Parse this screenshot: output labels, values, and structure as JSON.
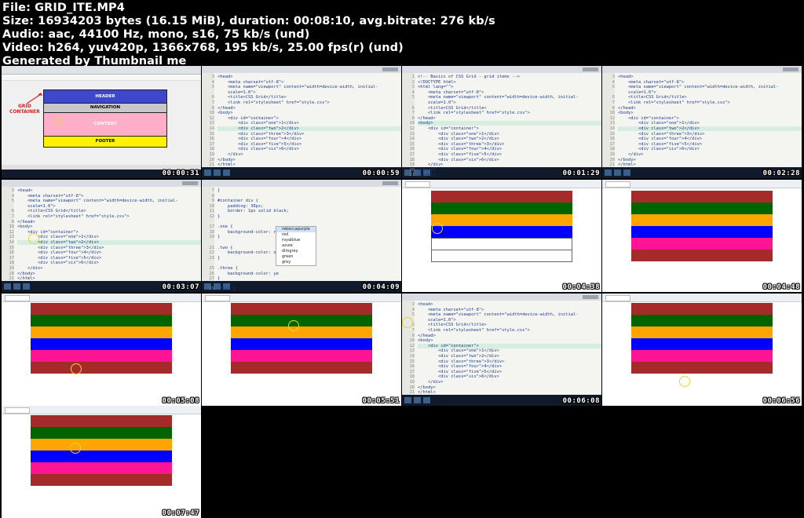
{
  "meta": {
    "file": "File: GRID_ITE.MP4",
    "size": "Size: 16934203 bytes (16.15 MiB), duration: 00:08:10, avg.bitrate: 276 kb/s",
    "audio": "Audio: aac, 44100 Hz, mono, s16, 75 kb/s (und)",
    "video": "Video: h264, yuv420p, 1366x768, 195 kb/s, 25.00 fps(r) (und)",
    "generated": "Generated by Thumbnail me"
  },
  "timestamps": [
    "00:00:31",
    "00:00:59",
    "00:01:29",
    "00:02:28",
    "00:03:07",
    "00:04:09",
    "00:04:38",
    "00:04:48",
    "00:05:08",
    "00:05:51",
    "00:06:08",
    "00:06:56",
    "00:07:47"
  ],
  "diagram": {
    "label_line1": "GRID",
    "label_line2": "CONTAINER",
    "header": "HEADER",
    "navigation": "NAVIGATION",
    "content": "CONTENT",
    "footer": "FOOTER",
    "colors": {
      "header": "#3f48cc",
      "navigation": "#c8c8c8",
      "content": "#ffaec9",
      "footer": "#fff200",
      "label": "#e02020"
    }
  },
  "code_html": [
    {
      "n": "3",
      "t": "<head>"
    },
    {
      "n": "4",
      "t": "    <meta charset=\"utf-8\">"
    },
    {
      "n": "5",
      "t": "    <meta name=\"viewport\" content=\"width=device-width, initial-"
    },
    {
      "n": "",
      "t": "    scale=1.0\">"
    },
    {
      "n": "6",
      "t": "    <title>CSS Grid</title>"
    },
    {
      "n": "7",
      "t": "    <link rel=\"stylesheet\" href=\"style.css\">"
    },
    {
      "n": "8",
      "t": "</head>"
    },
    {
      "n": "10",
      "t": "<body>"
    },
    {
      "n": "12",
      "t": "    <div id=\"container\">"
    },
    {
      "n": "13",
      "t": "        <div class=\"one\">1</div>"
    },
    {
      "n": "14",
      "t": "        <div class=\"two\">2</div>"
    },
    {
      "n": "15",
      "t": "        <div class=\"three\">3</div>"
    },
    {
      "n": "16",
      "t": "        <div class=\"four\">4</div>"
    },
    {
      "n": "17",
      "t": "        <div class=\"five\">5</div>"
    },
    {
      "n": "18",
      "t": "        <div class=\"six\">6</div>"
    },
    {
      "n": "19",
      "t": "    </div>"
    },
    {
      "n": "20",
      "t": "</body>"
    },
    {
      "n": "21",
      "t": "</html>"
    }
  ],
  "code_top": [
    {
      "n": "1",
      "t": "<!-- Basics of CSS Grid - grid items -->"
    },
    {
      "n": "2",
      "t": "<!DOCTYPE html>"
    },
    {
      "n": "3",
      "t": "<html lang=\"\">"
    }
  ],
  "code_css": [
    {
      "n": "7",
      "t": "}"
    },
    {
      "n": "8",
      "t": ""
    },
    {
      "n": "9",
      "t": "#container div {"
    },
    {
      "n": "10",
      "t": "    padding: 30px;"
    },
    {
      "n": "11",
      "t": "    border: 1px solid black;"
    },
    {
      "n": "12",
      "t": "}"
    },
    {
      "n": "",
      "t": ""
    },
    {
      "n": "17",
      "t": ".one {"
    },
    {
      "n": "18",
      "t": "    background-color: re"
    },
    {
      "n": "19",
      "t": "}"
    },
    {
      "n": "",
      "t": ""
    },
    {
      "n": "21",
      "t": ".two {"
    },
    {
      "n": "22",
      "t": "    background-color: or"
    },
    {
      "n": "23",
      "t": "}"
    },
    {
      "n": "",
      "t": ""
    },
    {
      "n": "25",
      "t": ".three {"
    },
    {
      "n": "26",
      "t": "    background-color: ye"
    },
    {
      "n": "27",
      "t": "}"
    },
    {
      "n": "",
      "t": ""
    },
    {
      "n": "29",
      "t": ".four {"
    },
    {
      "n": "30",
      "t": "    background-color: deepskb"
    }
  ],
  "autocomplete": [
    "rebeccapurple",
    "red",
    "royalblue",
    "azure",
    "dimgrey",
    "green",
    "grey"
  ],
  "grid_colors": {
    "four_rows": [
      "#a52a2a",
      "#006400",
      "#ffa500",
      "#0000ff"
    ],
    "six_rows": [
      "#a52a2a",
      "#006400",
      "#ffa500",
      "#0000ff",
      "#ff1493",
      "#a52a2a"
    ]
  }
}
